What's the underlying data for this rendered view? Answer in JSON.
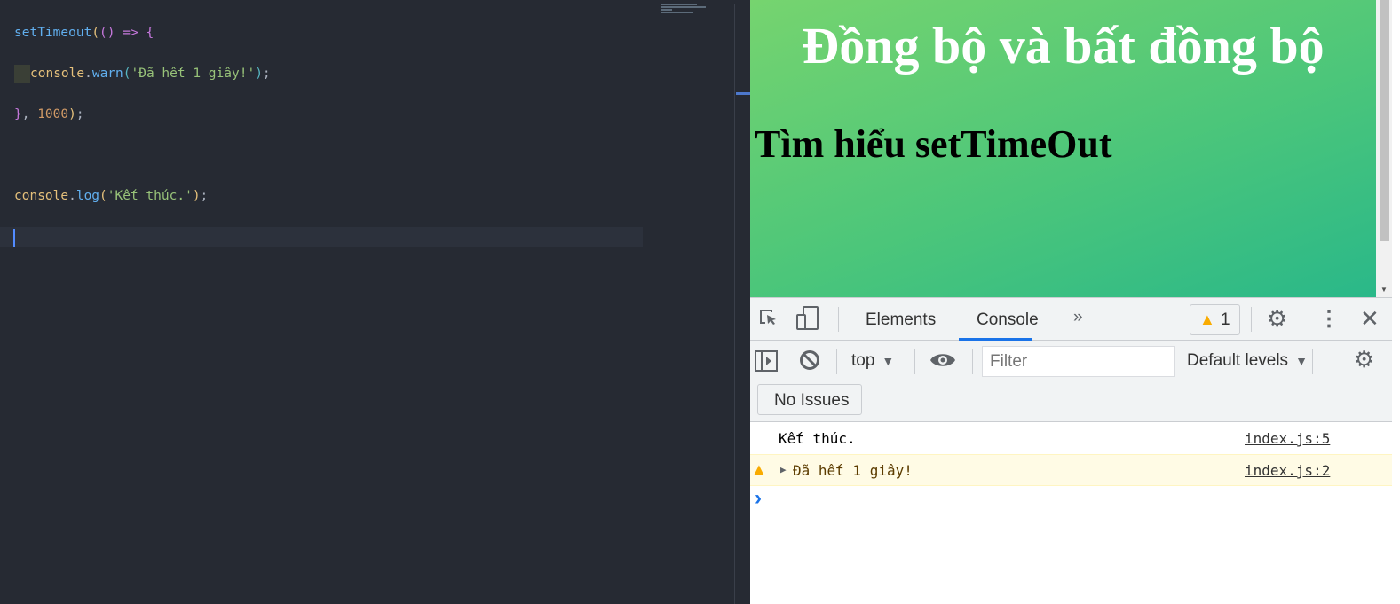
{
  "editor": {
    "lines": [
      {
        "t": "setTimeout(() => {"
      },
      {
        "t": "console.warn('Đã hết 1 giây!');"
      },
      {
        "t": "}, 1000);"
      },
      {
        "t": ""
      },
      {
        "t": "console.log('Kết thúc.');"
      }
    ],
    "code": {
      "l1a": "setTimeout",
      "l1b": "(",
      "l1c": "()",
      "l1d": " => ",
      "l1e": "{",
      "l2a": "console",
      "l2b": ".",
      "l2c": "warn",
      "l2d": "(",
      "l2e": "'Đã hết 1 giây!'",
      "l2f": ")",
      ";": ";",
      "l3a": "}",
      ",": ", ",
      "l3b": "1000",
      "l3c": ")",
      "l5a": "console",
      "l5b": ".",
      "l5c": "log",
      "l5d": "(",
      "l5e": "'Kết thúc.'",
      "l5f": ")"
    }
  },
  "page": {
    "title": "Đồng bộ và bất đồng bộ",
    "subtitle": "Tìm hiểu setTimeOut"
  },
  "devtools": {
    "tabs": [
      "Elements",
      "Console"
    ],
    "active_tab": "Console",
    "more": "»",
    "warning_count": "1",
    "context": "top",
    "filter_placeholder": "Filter",
    "levels": "Default levels",
    "issues": "No Issues",
    "messages": [
      {
        "level": "log",
        "text": "Kết thúc.",
        "source": "index.js:5"
      },
      {
        "level": "warn",
        "text": "Đã hết 1 giây!",
        "source": "index.js:2"
      }
    ],
    "prompt": "›"
  },
  "colors": {
    "accent": "#1a73e8",
    "warn_bg": "#fffbe5",
    "warn_text": "#5c3c00",
    "page_gradient_start": "#76d46f",
    "page_gradient_end": "#2ab889"
  }
}
